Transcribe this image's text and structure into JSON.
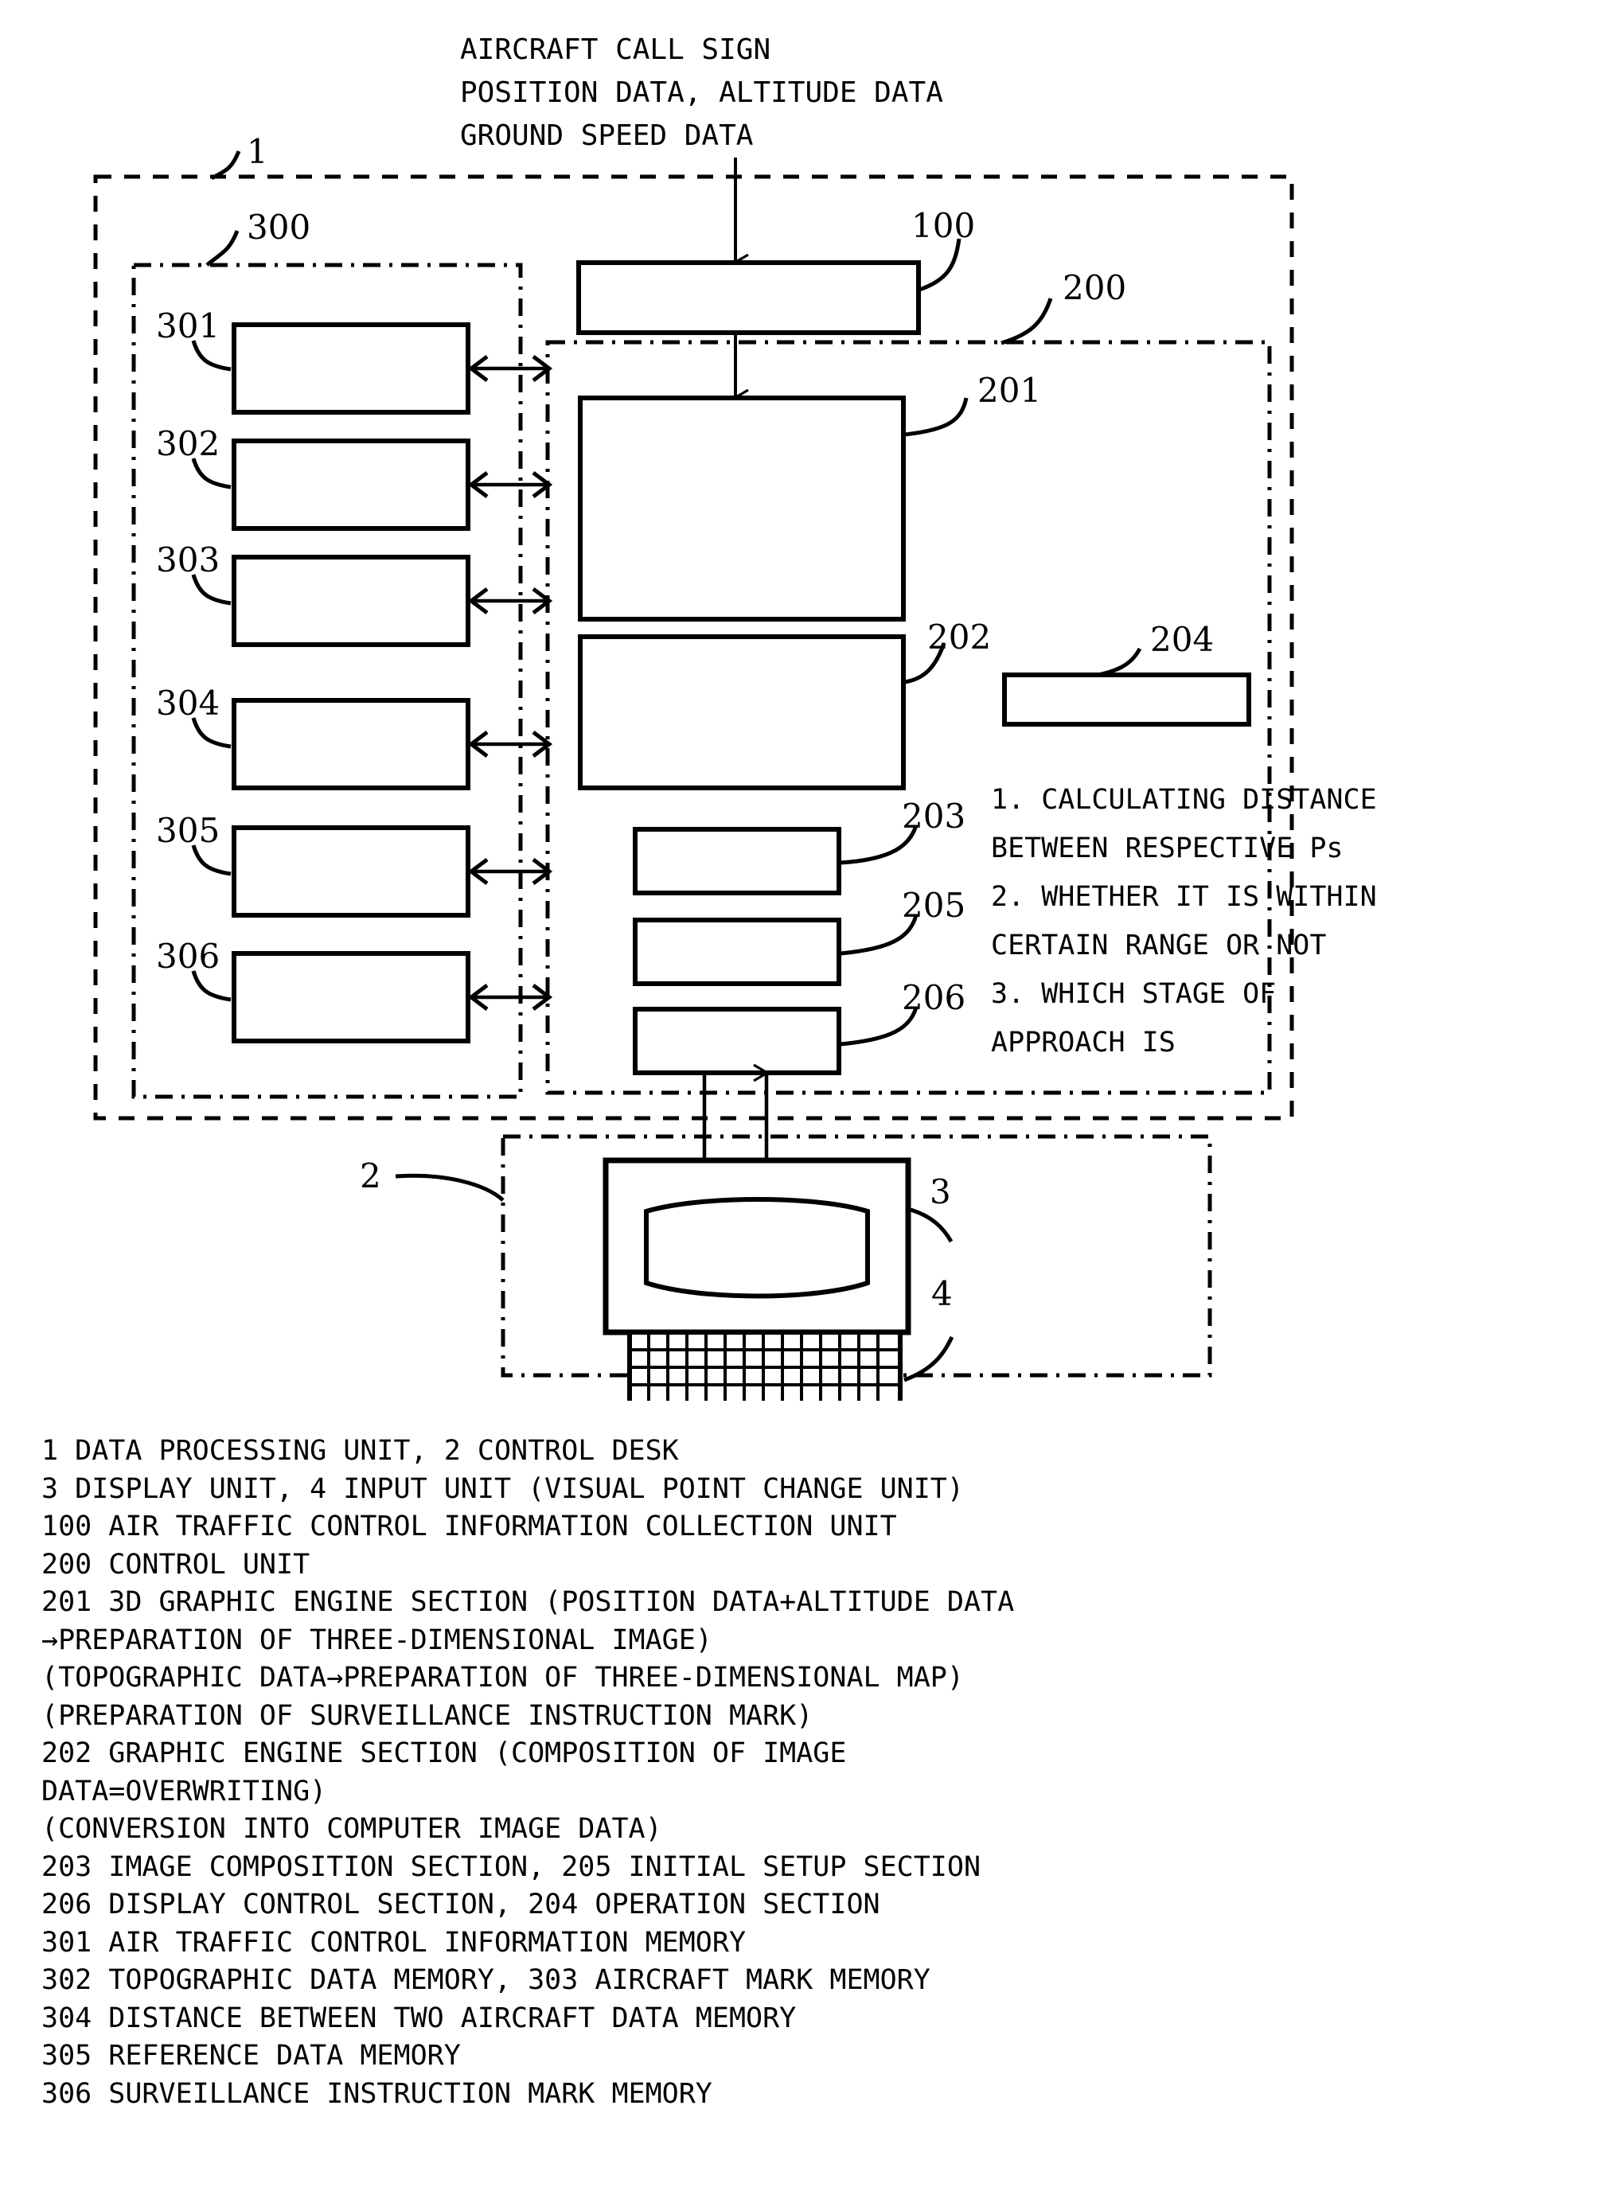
{
  "figure": {
    "input_caption": [
      "AIRCRAFT CALL SIGN",
      "POSITION DATA, ALTITUDE DATA",
      "GROUND SPEED DATA"
    ],
    "reference_labels": {
      "unit_1": "1",
      "desk_2": "2",
      "display_3": "3",
      "input_4": "4",
      "collection_100": "100",
      "control_200": "200",
      "graphic3d_201": "201",
      "graphic_202": "202",
      "composition_203": "203",
      "operation_204": "204",
      "initial_205": "205",
      "display_ctrl_206": "206",
      "memory_group_300": "300",
      "mem_301": "301",
      "mem_302": "302",
      "mem_303": "303",
      "mem_304": "304",
      "mem_305": "305",
      "mem_306": "306"
    },
    "calculation_notes": [
      "1. CALCULATING DISTANCE",
      "BETWEEN RESPECTIVE Ps",
      "2. WHETHER IT IS WITHIN",
      "CERTAIN RANGE OR NOT",
      "3. WHICH STAGE OF",
      "APPROACH IS"
    ]
  },
  "legend": {
    "lines": [
      "1 DATA PROCESSING UNIT, 2 CONTROL DESK",
      "3 DISPLAY UNIT, 4 INPUT UNIT (VISUAL POINT CHANGE UNIT)",
      "100 AIR TRAFFIC CONTROL INFORMATION COLLECTION UNIT",
      "200 CONTROL UNIT",
      "201 3D GRAPHIC ENGINE SECTION (POSITION DATA+ALTITUDE DATA",
      "→PREPARATION OF THREE-DIMENSIONAL IMAGE)",
      "(TOPOGRAPHIC DATA→PREPARATION OF THREE-DIMENSIONAL MAP)",
      "(PREPARATION OF SURVEILLANCE INSTRUCTION MARK)",
      "202 GRAPHIC ENGINE SECTION (COMPOSITION OF IMAGE",
      "DATA=OVERWRITING)",
      "(CONVERSION INTO COMPUTER IMAGE DATA)",
      "203 IMAGE COMPOSITION SECTION, 205 INITIAL SETUP SECTION",
      "206 DISPLAY CONTROL SECTION, 204 OPERATION SECTION",
      "301 AIR TRAFFIC CONTROL INFORMATION MEMORY",
      "302 TOPOGRAPHIC DATA MEMORY, 303 AIRCRAFT MARK MEMORY",
      "304 DISTANCE BETWEEN TWO AIRCRAFT DATA MEMORY",
      "305 REFERENCE DATA MEMORY",
      "306 SURVEILLANCE INSTRUCTION MARK MEMORY"
    ]
  },
  "colors": {
    "ink": "#000000",
    "paper": "#ffffff"
  }
}
